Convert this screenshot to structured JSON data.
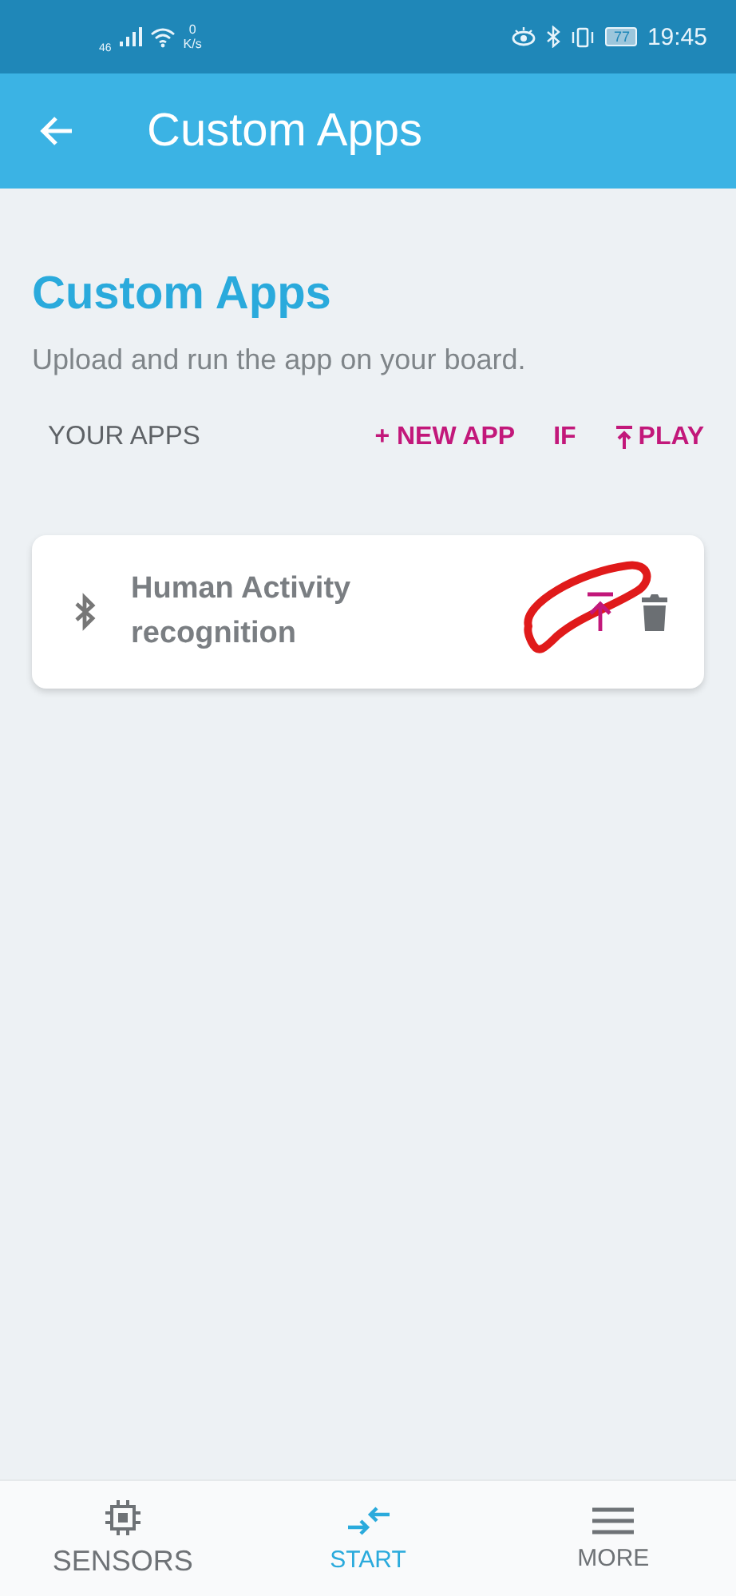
{
  "status_bar": {
    "network": "46",
    "speed_value": "0",
    "speed_unit": "K/s",
    "battery": "77",
    "time": "19:45"
  },
  "app_bar": {
    "title": "Custom Apps"
  },
  "heading": "Custom Apps",
  "subtitle": "Upload and run the app on your board.",
  "section": {
    "label": "YOUR APPS",
    "actions": [
      {
        "kind": "new",
        "label": "+ NEW APP"
      },
      {
        "kind": "if",
        "label": "IF"
      },
      {
        "kind": "play",
        "label": "PLAY"
      }
    ]
  },
  "apps": [
    {
      "name": "Human Activity recognition",
      "annotated": true
    }
  ],
  "bottom_nav": [
    {
      "kind": "sensors",
      "label": "SENSORS",
      "selected": false
    },
    {
      "kind": "start",
      "label": "START",
      "selected": true
    },
    {
      "kind": "more",
      "label": "MORE",
      "selected": false
    }
  ]
}
